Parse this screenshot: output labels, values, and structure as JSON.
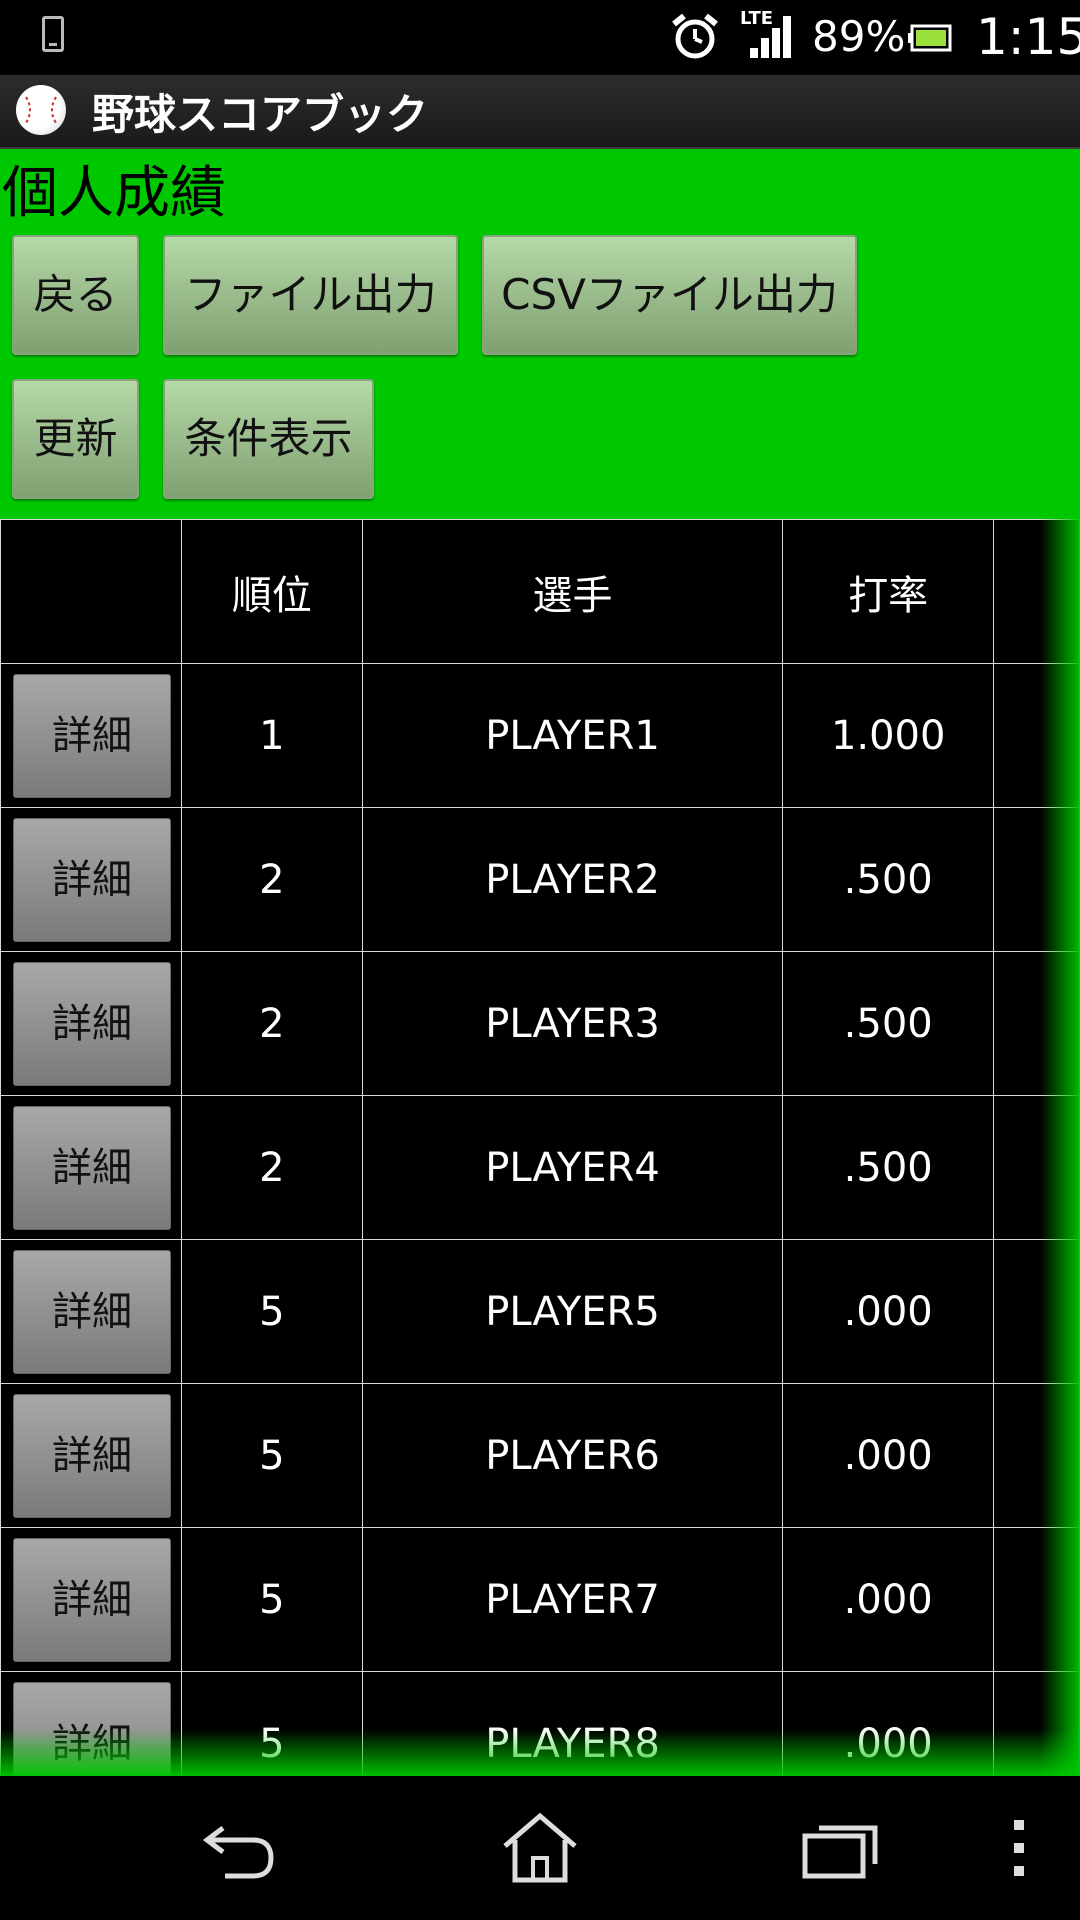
{
  "status_bar": {
    "network": "LTE",
    "battery_percent": "89%",
    "time": "1:15",
    "battery_color": "#9be03c"
  },
  "action_bar": {
    "title": "野球スコアブック",
    "icon": "baseball-icon"
  },
  "page": {
    "heading": "個人成績",
    "background": "#00c800"
  },
  "toolbar": {
    "back_label": "戻る",
    "file_output_label": "ファイル出力",
    "csv_output_label": "CSVファイル出力",
    "refresh_label": "更新",
    "conditions_label": "条件表示"
  },
  "table": {
    "headers": [
      "",
      "順位",
      "選手",
      "打率",
      ""
    ],
    "detail_label": "詳細",
    "rows": [
      {
        "rank": "1",
        "player": "PLAYER1",
        "avg": "1.000"
      },
      {
        "rank": "2",
        "player": "PLAYER2",
        "avg": ".500"
      },
      {
        "rank": "2",
        "player": "PLAYER3",
        "avg": ".500"
      },
      {
        "rank": "2",
        "player": "PLAYER4",
        "avg": ".500"
      },
      {
        "rank": "5",
        "player": "PLAYER5",
        "avg": ".000"
      },
      {
        "rank": "5",
        "player": "PLAYER6",
        "avg": ".000"
      },
      {
        "rank": "5",
        "player": "PLAYER7",
        "avg": ".000"
      },
      {
        "rank": "5",
        "player": "PLAYER8",
        "avg": ".000"
      }
    ]
  },
  "nav_bar": {
    "icons": [
      "back-icon",
      "home-icon",
      "recent-apps-icon",
      "overflow-menu-icon"
    ]
  }
}
